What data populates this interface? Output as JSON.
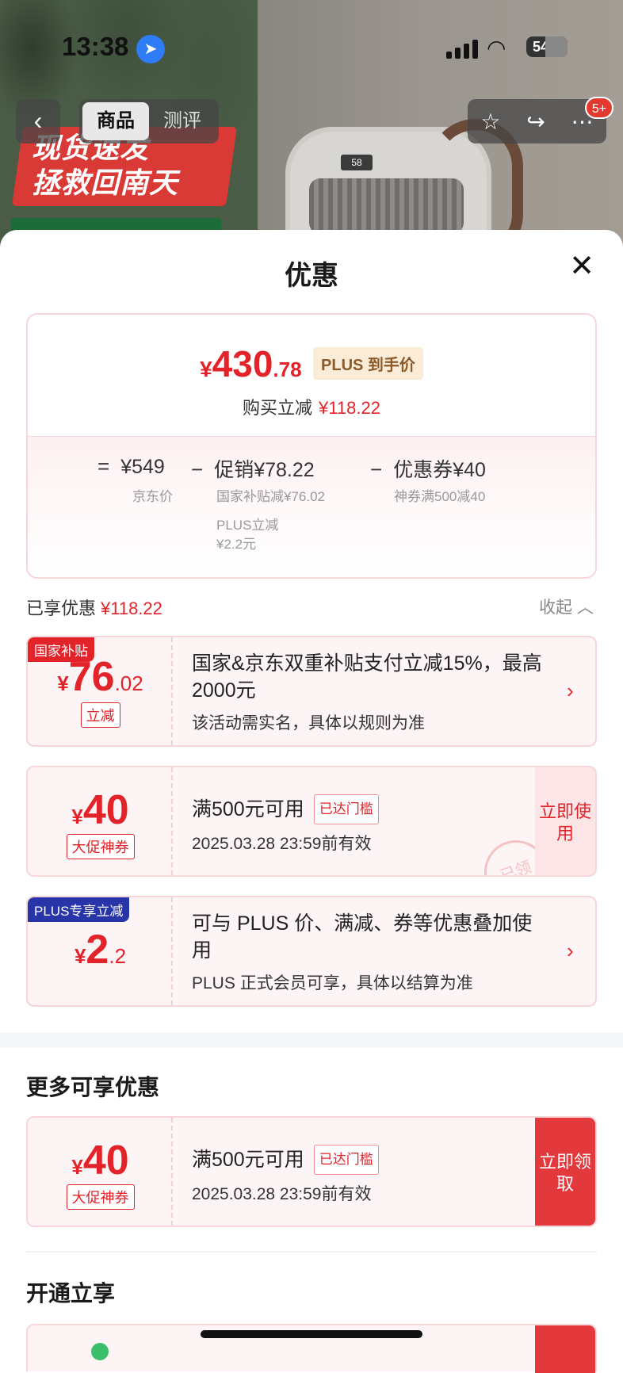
{
  "status_bar": {
    "time": "13:38",
    "battery": "54"
  },
  "nav": {
    "back_icon": "chevron-left-icon",
    "tabs": [
      {
        "label": "商品",
        "active": true
      },
      {
        "label": "测评",
        "active": false
      }
    ],
    "badge": "5+"
  },
  "banner": {
    "line1": "现货速发",
    "line2": "拯救回南天",
    "display": "58"
  },
  "sheet": {
    "title": "优惠",
    "summary": {
      "yen": "¥",
      "price_int": "430",
      "price_dec": ".78",
      "plus_tag": "PLUS 到手价",
      "reduce_label": "购买立减",
      "reduce_value": "¥118.22",
      "base_op": "=",
      "base_price": "¥549",
      "base_label": "京东价",
      "promo_op": "−",
      "promo_text": "促销¥78.22",
      "promo_sub1": "国家补贴减¥76.02",
      "promo_sub2": "PLUS立减",
      "promo_sub3": "¥2.2元",
      "coupon_op": "−",
      "coupon_text": "优惠券¥40",
      "coupon_sub": "神券满500减40"
    },
    "applied": {
      "label": "已享优惠",
      "value": "¥118.22",
      "collapse": "收起"
    },
    "coupons": [
      {
        "tag": "国家补贴",
        "yen": "¥",
        "int": "76",
        "dec": ".02",
        "label": "立减",
        "title": "国家&京东双重补贴支付立减15%，最高2000元",
        "sub": "该活动需实名，具体以规则为准"
      },
      {
        "yen": "¥",
        "int": "40",
        "dec": "",
        "label": "大促神券",
        "title": "满500元可用",
        "reach": "已达门槛",
        "sub": "2025.03.28 23:59前有效",
        "btn": "立即使用",
        "stamp": "已领"
      },
      {
        "tag": "PLUS专享立减",
        "yen": "¥",
        "int": "2",
        "dec": ".2",
        "title": "可与 PLUS 价、满减、券等优惠叠加使用",
        "sub": "PLUS 正式会员可享，具体以结算为准"
      }
    ],
    "more_title": "更多可享优惠",
    "more_coupon": {
      "yen": "¥",
      "int": "40",
      "label": "大促神券",
      "title": "满500元可用",
      "reach": "已达门槛",
      "sub": "2025.03.28 23:59前有效",
      "btn": "立即领取"
    },
    "open_title": "开通立享"
  },
  "colors": {
    "accent": "#e2232a",
    "plus_blue": "#2735a8",
    "plus_gold_bg": "#fbecd7"
  }
}
